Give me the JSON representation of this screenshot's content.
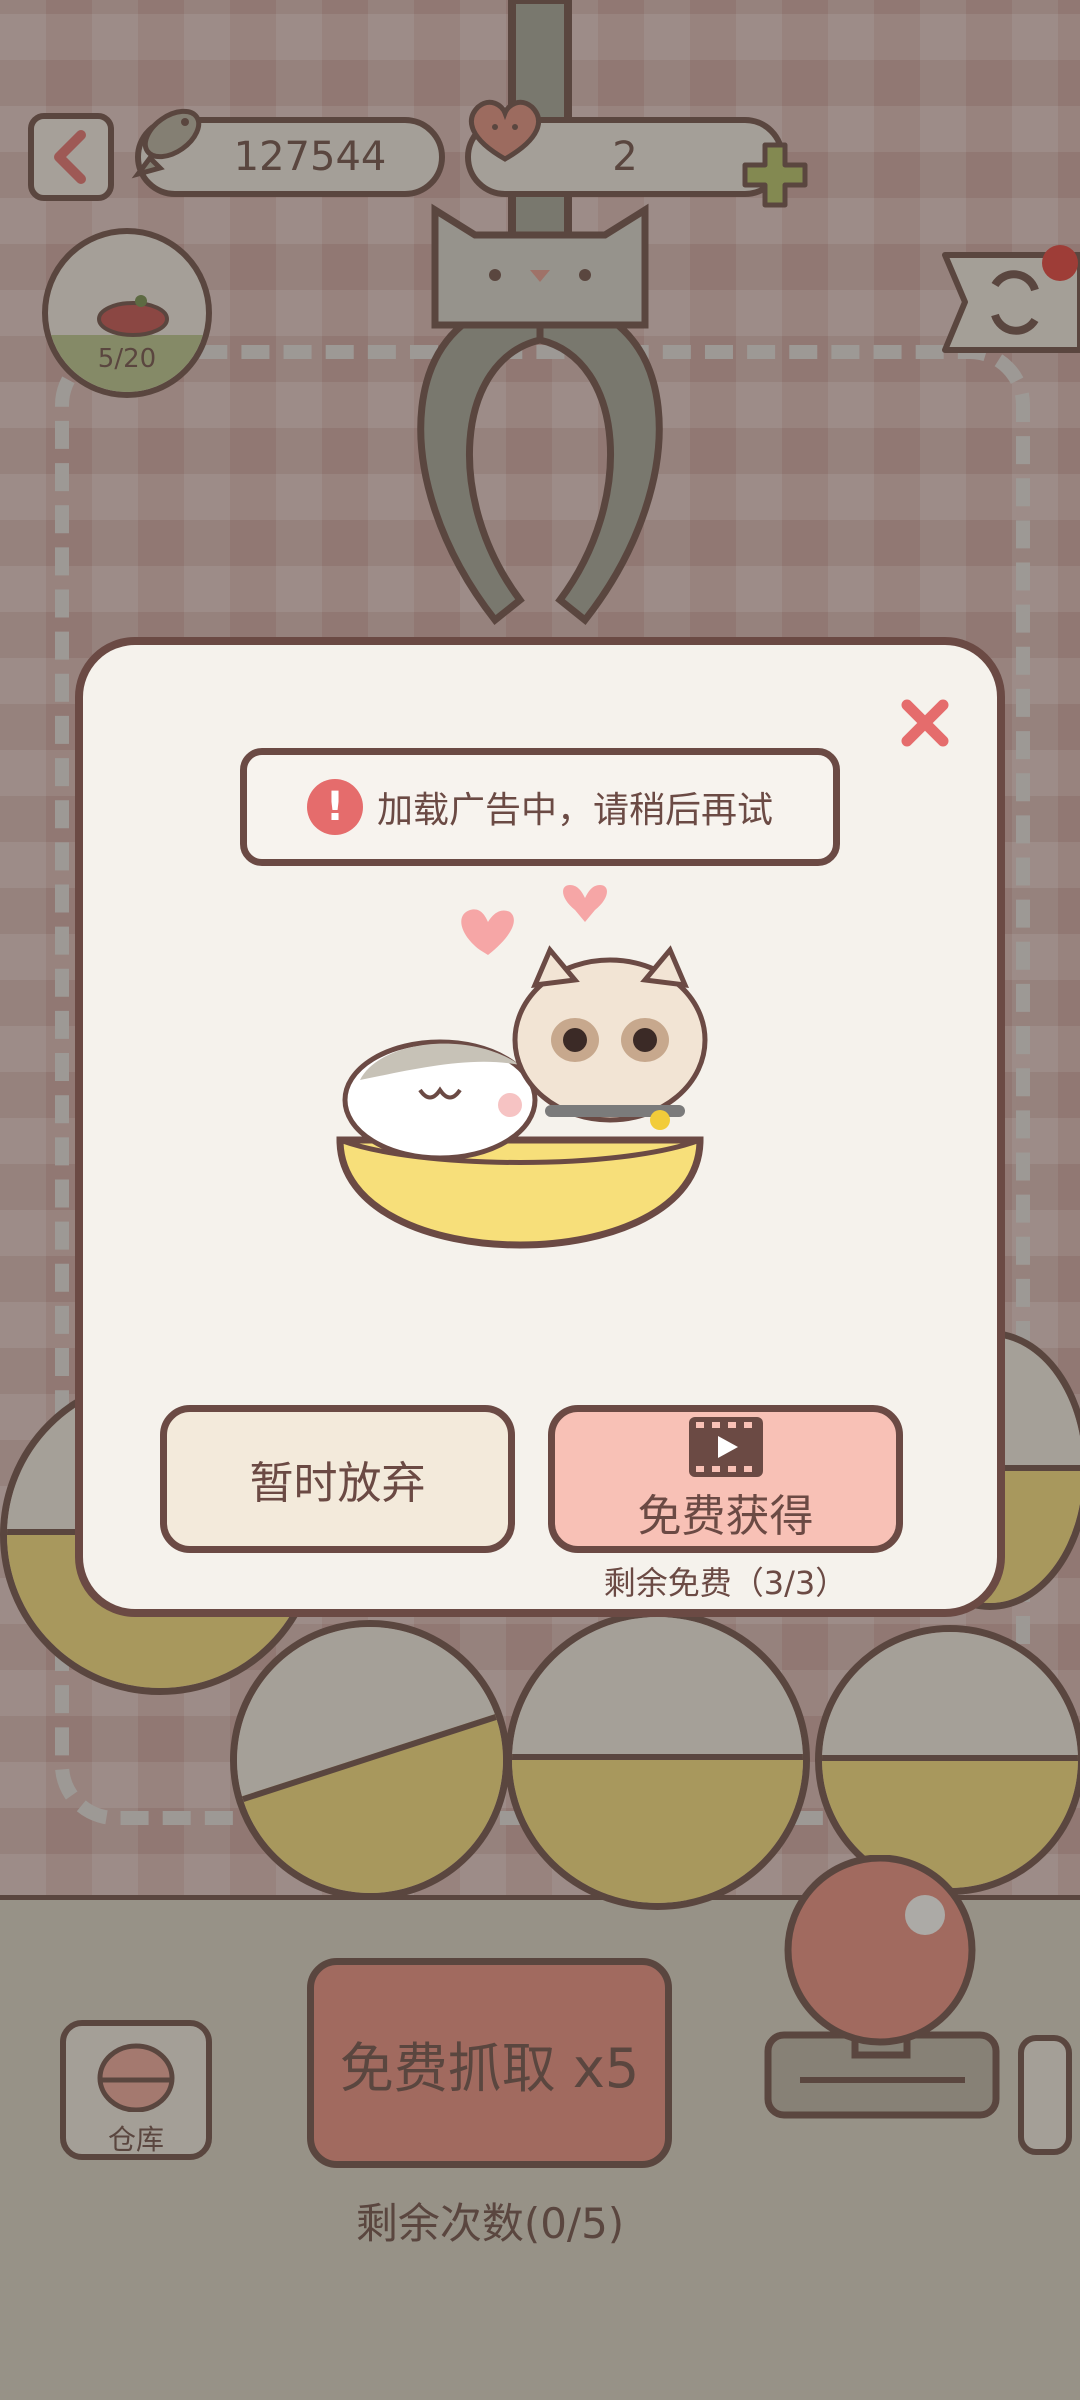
{
  "top_bar": {
    "fish_count": "127544",
    "heart_count": "2",
    "lives": "5/20"
  },
  "claw_area": {},
  "controls": {
    "warehouse_label": "仓库",
    "grab_label": "免费抓取 x5",
    "grab_remaining": "剩余次数(0/5)"
  },
  "dialog": {
    "toast_text": "加载广告中，请稍后再试",
    "give_up_label": "暂时放弃",
    "free_get_label": "免费获得",
    "free_remaining": "剩余免费（3/3）"
  },
  "colors": {
    "outline": "#6b4a44",
    "accent_red": "#e56c6c",
    "button_pink": "#f8c1b6",
    "ball_yellow": "#f7df7a"
  },
  "icons": [
    "back-arrow-icon",
    "fish-icon",
    "heart-icon",
    "plus-icon",
    "beret-icon",
    "refresh-icon",
    "close-icon",
    "alert-icon",
    "video-icon",
    "warehouse-icon"
  ]
}
